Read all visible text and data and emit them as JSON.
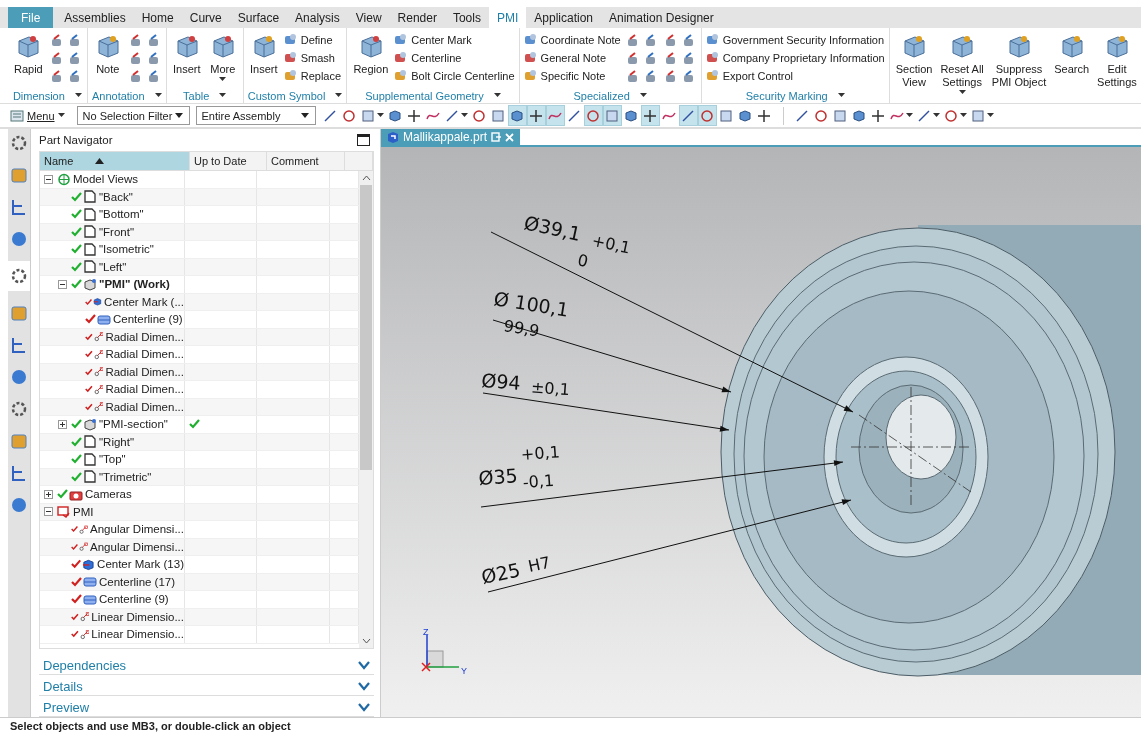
{
  "tabs": [
    {
      "label": "File",
      "kind": "file",
      "selected": false
    },
    {
      "label": "Assemblies",
      "kind": "tab",
      "selected": false
    },
    {
      "label": "Home",
      "kind": "tab",
      "selected": false
    },
    {
      "label": "Curve",
      "kind": "tab",
      "selected": false
    },
    {
      "label": "Surface",
      "kind": "tab",
      "selected": false
    },
    {
      "label": "Analysis",
      "kind": "tab",
      "selected": false
    },
    {
      "label": "View",
      "kind": "tab",
      "selected": false
    },
    {
      "label": "Render",
      "kind": "tab",
      "selected": false
    },
    {
      "label": "Tools",
      "kind": "tab",
      "selected": false
    },
    {
      "label": "PMI",
      "kind": "tab",
      "selected": true
    },
    {
      "label": "Application",
      "kind": "tab",
      "selected": false
    },
    {
      "label": "Animation Designer",
      "kind": "tab",
      "selected": false
    }
  ],
  "ribbon": [
    {
      "title": "Dimension",
      "menu": true,
      "items": [
        {
          "kind": "large",
          "label": "Rapid"
        },
        {
          "kind": "icons"
        }
      ]
    },
    {
      "title": "Annotation",
      "menu": true,
      "items": [
        {
          "kind": "large",
          "label": "Note"
        },
        {
          "kind": "icons"
        }
      ]
    },
    {
      "title": "Table",
      "menu": true,
      "items": [
        {
          "kind": "large",
          "label": "Insert"
        },
        {
          "kind": "large",
          "label": "More",
          "dropdown": true
        }
      ]
    },
    {
      "title": "Custom Symbol",
      "menu": true,
      "items": [
        {
          "kind": "large",
          "label": "Insert"
        },
        {
          "kind": "list",
          "entries": [
            "Define",
            "Smash",
            "Replace"
          ]
        }
      ]
    },
    {
      "title": "Supplemental Geometry",
      "menu": true,
      "items": [
        {
          "kind": "large",
          "label": "Region"
        },
        {
          "kind": "list",
          "entries": [
            "Center Mark",
            "Centerline",
            "Bolt Circle Centerline"
          ]
        }
      ]
    },
    {
      "title": "Specialized",
      "menu": true,
      "items": [
        {
          "kind": "list",
          "entries": [
            "Coordinate Note",
            "General Note",
            "Specific Note"
          ]
        },
        {
          "kind": "icons"
        },
        {
          "kind": "icons"
        }
      ]
    },
    {
      "title": "Security Marking",
      "menu": true,
      "items": [
        {
          "kind": "list",
          "entries": [
            "Government Security Information",
            "Company Proprietary Information",
            "Export Control"
          ]
        }
      ]
    },
    {
      "items": [
        {
          "kind": "large",
          "label": "Section\nView"
        },
        {
          "kind": "large",
          "label": "Reset All\nSettings",
          "dropdown": true
        },
        {
          "kind": "large",
          "label": "Suppress\nPMI Object"
        },
        {
          "kind": "large",
          "label": "Search"
        },
        {
          "kind": "large",
          "label": "Edit\nSettings"
        }
      ]
    }
  ],
  "toolbar": {
    "menu": "Menu",
    "selection_filter": "No Selection Filter",
    "scope": "Entire Assembly",
    "tools": [
      {
        "kind": "tool",
        "selected": false
      },
      {
        "kind": "tool",
        "selected": false
      },
      {
        "kind": "tool",
        "selected": false,
        "dropdown": true
      },
      {
        "kind": "tool",
        "selected": false
      },
      {
        "kind": "tool",
        "selected": false
      },
      {
        "kind": "tool",
        "selected": false
      },
      {
        "kind": "tool",
        "selected": false,
        "dropdown": true
      },
      {
        "kind": "tool",
        "selected": false
      },
      {
        "kind": "tool",
        "selected": false
      },
      {
        "kind": "tool",
        "selected": true
      },
      {
        "kind": "tool",
        "selected": true
      },
      {
        "kind": "tool",
        "selected": true
      },
      {
        "kind": "tool",
        "selected": false
      },
      {
        "kind": "tool",
        "selected": true
      },
      {
        "kind": "tool",
        "selected": true
      },
      {
        "kind": "tool",
        "selected": false
      },
      {
        "kind": "tool",
        "selected": true
      },
      {
        "kind": "tool",
        "selected": false
      },
      {
        "kind": "tool",
        "selected": true
      },
      {
        "kind": "tool",
        "selected": true
      },
      {
        "kind": "tool",
        "selected": false
      },
      {
        "kind": "tool",
        "selected": false
      },
      {
        "kind": "tool",
        "selected": false
      },
      {
        "kind": "separator"
      },
      {
        "kind": "tool",
        "selected": false
      },
      {
        "kind": "tool",
        "selected": false
      },
      {
        "kind": "tool",
        "selected": false
      },
      {
        "kind": "tool",
        "selected": false
      },
      {
        "kind": "tool",
        "selected": false
      },
      {
        "kind": "tool",
        "selected": false,
        "dropdown": true
      },
      {
        "kind": "tool",
        "selected": false,
        "dropdown": true
      },
      {
        "kind": "tool",
        "selected": false,
        "dropdown": true
      },
      {
        "kind": "tool",
        "selected": false,
        "dropdown": true
      }
    ]
  },
  "resource_bar": [
    {
      "selected": false
    },
    {
      "selected": false
    },
    {
      "selected": false
    },
    {
      "selected": false
    },
    {
      "selected": true
    },
    {
      "selected": false
    },
    {
      "selected": false
    },
    {
      "selected": false
    },
    {
      "selected": false
    },
    {
      "selected": false
    },
    {
      "selected": false
    },
    {
      "selected": false
    }
  ],
  "navigator": {
    "title": "Part Navigator",
    "columns": [
      {
        "label": "Name",
        "sorted": true
      },
      {
        "label": "Up to Date",
        "sorted": false
      },
      {
        "label": "Comment",
        "sorted": false
      }
    ],
    "tree": [
      {
        "label": "Model Views",
        "kind": "views",
        "expanded": true,
        "children": [
          {
            "label": "\"Back\"",
            "kind": "view",
            "checked": true
          },
          {
            "label": "\"Bottom\"",
            "kind": "view",
            "checked": true
          },
          {
            "label": "\"Front\"",
            "kind": "view",
            "checked": true
          },
          {
            "label": "\"Isometric\"",
            "kind": "view",
            "checked": true
          },
          {
            "label": "\"Left\"",
            "kind": "view",
            "checked": true
          },
          {
            "label": "\"PMI\" (Work)",
            "kind": "pmi-view",
            "checked": true,
            "active": true,
            "expanded": true,
            "children": [
              {
                "label": "Center Mark (...",
                "kind": "center-mark",
                "checked": true
              },
              {
                "label": "Centerline (9)",
                "kind": "centerline",
                "checked": true
              },
              {
                "label": "Radial Dimen...",
                "kind": "dimension",
                "checked": true
              },
              {
                "label": "Radial Dimen...",
                "kind": "dimension",
                "checked": true
              },
              {
                "label": "Radial Dimen...",
                "kind": "dimension",
                "checked": true
              },
              {
                "label": "Radial Dimen...",
                "kind": "dimension",
                "checked": true
              },
              {
                "label": "Radial Dimen...",
                "kind": "dimension",
                "checked": true
              }
            ]
          },
          {
            "label": "\"PMI-section\"",
            "kind": "pmi-view",
            "checked": true,
            "expanded": false,
            "up_to_date": true
          },
          {
            "label": "\"Right\"",
            "kind": "view",
            "checked": true
          },
          {
            "label": "\"Top\"",
            "kind": "view",
            "checked": true
          },
          {
            "label": "\"Trimetric\"",
            "kind": "view",
            "checked": true
          }
        ]
      },
      {
        "label": "Cameras",
        "kind": "camera",
        "checked": true,
        "expanded": false
      },
      {
        "label": "PMI",
        "kind": "pmi",
        "expanded": true,
        "children": [
          {
            "label": "Angular Dimensi...",
            "kind": "dimension",
            "checked": true
          },
          {
            "label": "Angular Dimensi...",
            "kind": "dimension",
            "checked": true
          },
          {
            "label": "Center Mark (13)",
            "kind": "center-mark",
            "checked": true
          },
          {
            "label": "Centerline (17)",
            "kind": "centerline",
            "checked": true
          },
          {
            "label": "Centerline (9)",
            "kind": "centerline",
            "checked": true
          },
          {
            "label": "Linear Dimensio...",
            "kind": "dimension",
            "checked": true
          },
          {
            "label": "Linear Dimensio...",
            "kind": "dimension",
            "checked": true
          }
        ]
      }
    ],
    "sections": [
      {
        "label": "Dependencies",
        "expanded": false
      },
      {
        "label": "Details",
        "expanded": false
      },
      {
        "label": "Preview",
        "expanded": false
      }
    ]
  },
  "viewport": {
    "tab": "Mallikappale.prt",
    "annotations": [
      {
        "texts": [
          "Ø39,1",
          "+0,1",
          "0"
        ]
      },
      {
        "texts": [
          "Ø 100,1",
          "99,9"
        ]
      },
      {
        "texts": [
          "Ø94",
          "±0,1"
        ]
      },
      {
        "texts": [
          "Ø35",
          "+0,1",
          "-0,1"
        ]
      },
      {
        "texts": [
          "Ø25",
          "H7"
        ]
      }
    ],
    "triad": {
      "z": "Z",
      "y": "Y"
    }
  },
  "status_bar": "Select objects and use MB3, or double-click an object"
}
